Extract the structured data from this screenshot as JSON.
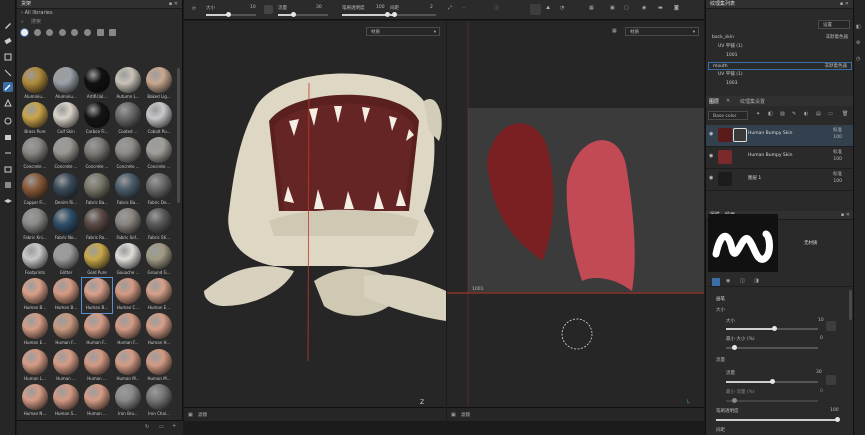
{
  "shelf": {
    "title": "货架",
    "path": "All libraries",
    "search_placeholder": "搜索",
    "materials": [
      {
        "label": "Aluminiu...",
        "color": "#b08a3a"
      },
      {
        "label": "Aluminiu...",
        "color": "#9aa0a6"
      },
      {
        "label": "Artificial...",
        "color": "#111111"
      },
      {
        "label": "Autumn L...",
        "color": "#c8c2b8"
      },
      {
        "label": "Baked Lig...",
        "color": "#c9a890"
      },
      {
        "label": "Brass Pure",
        "color": "#c9a34a"
      },
      {
        "label": "Calf Skin",
        "color": "#d9d3c9"
      },
      {
        "label": "Carbon Fi...",
        "color": "#151515"
      },
      {
        "label": "Coated ...",
        "color": "#6a6a6a"
      },
      {
        "label": "Cobalt Pu...",
        "color": "#c8c8cc"
      },
      {
        "label": "Concrete ...",
        "color": "#8a8783"
      },
      {
        "label": "Concrete ...",
        "color": "#9a9792"
      },
      {
        "label": "Concrete ...",
        "color": "#7d7a76"
      },
      {
        "label": "Concrete ...",
        "color": "#8f8c88"
      },
      {
        "label": "Concrete ...",
        "color": "#a19e99"
      },
      {
        "label": "Copper Fi...",
        "color": "#8a5a3a"
      },
      {
        "label": "Denim Ri...",
        "color": "#3a4a5a"
      },
      {
        "label": "Fabric Ba...",
        "color": "#7a7768"
      },
      {
        "label": "Fabric Ba...",
        "color": "#4a5d6a"
      },
      {
        "label": "Fabric De...",
        "color": "#6a6a6a"
      },
      {
        "label": "Fabric Kni...",
        "color": "#8a8a88"
      },
      {
        "label": "Fabric No...",
        "color": "#2f4f6a"
      },
      {
        "label": "Fabric Ro...",
        "color": "#5a4a46"
      },
      {
        "label": "Fabric Sof...",
        "color": "#8a8580"
      },
      {
        "label": "Fabric Sti...",
        "color": "#5a5a5a"
      },
      {
        "label": "Footprints",
        "color": "#c8c8c8"
      },
      {
        "label": "Glitter",
        "color": "#9a9a9a"
      },
      {
        "label": "Gold Pure",
        "color": "#c9a84a"
      },
      {
        "label": "Gouache ...",
        "color": "#e0ddd8"
      },
      {
        "label": "Ground G...",
        "color": "#a09a85"
      },
      {
        "label": "Human B...",
        "color": "#d9a088"
      },
      {
        "label": "Human B...",
        "color": "#d69a82"
      },
      {
        "label": "Human B...",
        "color": "#d8a08a"
      },
      {
        "label": "Human C...",
        "color": "#d49a84"
      },
      {
        "label": "Human E...",
        "color": "#d6a08a"
      },
      {
        "label": "Human E...",
        "color": "#d59c86"
      },
      {
        "label": "Human F...",
        "color": "#c89a80"
      },
      {
        "label": "Human F...",
        "color": "#d59c86"
      },
      {
        "label": "Human F...",
        "color": "#d39a84"
      },
      {
        "label": "Human H...",
        "color": "#d69e88"
      },
      {
        "label": "Human L...",
        "color": "#d59c86"
      },
      {
        "label": "Human ...",
        "color": "#d59c86"
      },
      {
        "label": "Human ...",
        "color": "#d39a84"
      },
      {
        "label": "Human M...",
        "color": "#d59c86"
      },
      {
        "label": "Human M...",
        "color": "#d39a84"
      },
      {
        "label": "Human N...",
        "color": "#d59c86"
      },
      {
        "label": "Human S...",
        "color": "#d39a84"
      },
      {
        "label": "Human ...",
        "color": "#d59c86"
      },
      {
        "label": "Iron Bru...",
        "color": "#8a8a8a"
      },
      {
        "label": "Iron Chai...",
        "color": "#777777"
      }
    ]
  },
  "toolbar": {
    "size_label": "大小",
    "size_value": "10",
    "flow_label": "流量",
    "flow_value": "30",
    "opacity_label": "笔刷透明度",
    "opacity_value": "100",
    "spacing_label": "间距",
    "spacing_value": "2"
  },
  "viewport3d": {
    "mode": "材质",
    "footer": "滤镜",
    "axis": "Z"
  },
  "viewport2d": {
    "mode": "材质",
    "footer": "滤镜",
    "uv_tile": "1001"
  },
  "texture_sets": {
    "title": "纹理集列表",
    "settings": "设置",
    "rows": [
      {
        "name": "back_skin",
        "tag": "非默着色器"
      },
      {
        "name": "UV 平铺 (1)",
        "tag": ""
      },
      {
        "name": "1001",
        "tag": ""
      },
      {
        "name": "mouth",
        "tag": "非默着色器"
      },
      {
        "name": "UV 平铺 (1)",
        "tag": ""
      },
      {
        "name": "1003",
        "tag": ""
      }
    ]
  },
  "layers": {
    "tab_layers": "图层",
    "tab_texset": "纹理集设置",
    "channel": "Base color",
    "items": [
      {
        "name": "Human Bumpy Skin",
        "blend": "标准",
        "opacity": "100"
      },
      {
        "name": "Human Bumpy Skin",
        "blend": "标准",
        "opacity": "100"
      },
      {
        "name": "图层 1",
        "blend": "标准",
        "opacity": "100"
      }
    ]
  },
  "properties": {
    "title": "属性 - 绘画",
    "brush_name": "无材质",
    "section": "画笔",
    "size_label": "大小",
    "size_label2": "大小",
    "size_value": "10",
    "minsize_label": "最小 大小 (%)",
    "minsize_value": "0",
    "flow_section": "流量",
    "flow_label": "流量",
    "flow_value": "30",
    "minflow_label": "最小 流量 (%)",
    "minflow_value": "0",
    "opacity_label": "笔刷透明度",
    "opacity_value": "100",
    "spacing_label": "间距"
  },
  "colors": {
    "accent": "#3a6ea8",
    "selection": "#5a8fd0",
    "uv_red": "#c0392b"
  }
}
